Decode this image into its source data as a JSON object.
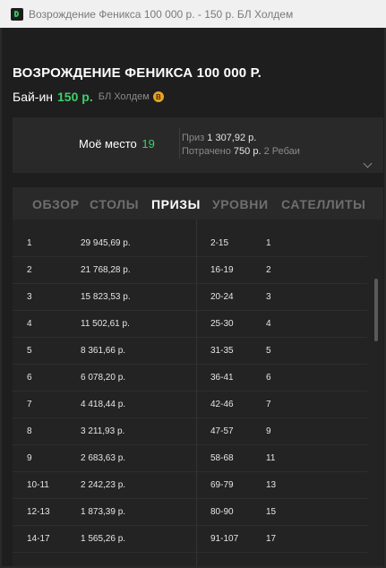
{
  "window": {
    "title": "Возрождение Феникса 100 000 р. - 150 р. БЛ Холдем"
  },
  "tournament": {
    "name": "ВОЗРОЖДЕНИЕ ФЕНИКСА 100 000 Р.",
    "buyin_label": "Бай-ин",
    "buyin_value": "150 р.",
    "game_type": "БЛ Холдем",
    "coin_label": "В"
  },
  "summary": {
    "place_label": "Моё место",
    "place_value": "19",
    "prize_label": "Приз",
    "prize_value": "1 307,92 р.",
    "spent_label": "Потрачено",
    "spent_value": "750 р.",
    "rebuys": "2 Ребаи"
  },
  "tabs": [
    {
      "label": "ОБЗОР"
    },
    {
      "label": "СТОЛЫ"
    },
    {
      "label": "ПРИЗЫ"
    },
    {
      "label": "УРОВНИ"
    },
    {
      "label": "САТЕЛЛИТЫ"
    }
  ],
  "active_tab": "ПРИЗЫ",
  "prizes": [
    {
      "place": "1",
      "amount": "29 945,69 р."
    },
    {
      "place": "2",
      "amount": "21 768,28 р."
    },
    {
      "place": "3",
      "amount": "15 823,53 р."
    },
    {
      "place": "4",
      "amount": "11 502,61 р."
    },
    {
      "place": "5",
      "amount": "8 361,66 р."
    },
    {
      "place": "6",
      "amount": "6 078,20 р."
    },
    {
      "place": "7",
      "amount": "4 418,44 р."
    },
    {
      "place": "8",
      "amount": "3 211,93 р."
    },
    {
      "place": "9",
      "amount": "2 683,63 р."
    },
    {
      "place": "10-11",
      "amount": "2 242,23 р."
    },
    {
      "place": "12-13",
      "amount": "1 873,39 р."
    },
    {
      "place": "14-17",
      "amount": "1 565,26 р."
    }
  ],
  "tickets": [
    {
      "range": "2-15",
      "count": "1"
    },
    {
      "range": "16-19",
      "count": "2"
    },
    {
      "range": "20-24",
      "count": "3"
    },
    {
      "range": "25-30",
      "count": "4"
    },
    {
      "range": "31-35",
      "count": "5"
    },
    {
      "range": "36-41",
      "count": "6"
    },
    {
      "range": "42-46",
      "count": "7"
    },
    {
      "range": "47-57",
      "count": "9"
    },
    {
      "range": "58-68",
      "count": "11"
    },
    {
      "range": "69-79",
      "count": "13"
    },
    {
      "range": "80-90",
      "count": "15"
    },
    {
      "range": "91-107",
      "count": "17"
    }
  ],
  "colors": {
    "accent_green": "#3ecf6a",
    "coin": "#e8a421",
    "background": "#1e1e1e"
  }
}
